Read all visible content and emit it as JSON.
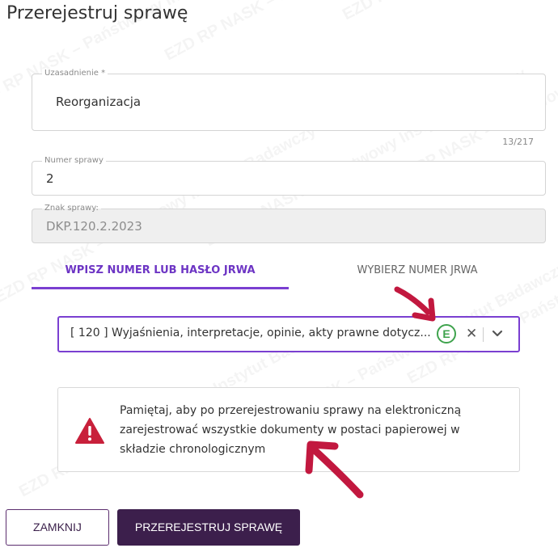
{
  "dialog": {
    "title": "Przerejestruj sprawę"
  },
  "fields": {
    "justification": {
      "label": "Uzasadnienie *",
      "value": "Reorganizacja",
      "counter": "13/217"
    },
    "case_number": {
      "label": "Numer sprawy",
      "value": "2"
    },
    "case_sign": {
      "label": "Znak sprawy:",
      "value": "DKP.120.2.2023"
    }
  },
  "tabs": [
    {
      "label": "WPISZ NUMER LUB HASŁO JRWA",
      "active": true
    },
    {
      "label": "WYBIERZ NUMER JRWA",
      "active": false
    }
  ],
  "jrwa_select": {
    "value": "[ 120 ]  Wyjaśnienia, interpretacje, opinie, akty prawne dotycz...",
    "badge": "E"
  },
  "alert": {
    "text": "Pamiętaj, aby po przerejestrowaniu sprawy na elektroniczną zarejestrować wszystkie dokumenty w postaci papierowej w składzie chronologicznym"
  },
  "buttons": {
    "close": "ZAMKNIJ",
    "submit": "PRZEREJESTRUJ SPRAWĘ"
  },
  "watermark": "EZD RP  NASK – Państwowy Instytut Badawczy",
  "colors": {
    "accent": "#7a3fd1",
    "primary_button": "#3c1f4c",
    "warning": "#c8203b",
    "badge": "#3fa34d",
    "annotation_arrow": "#c2183f"
  }
}
